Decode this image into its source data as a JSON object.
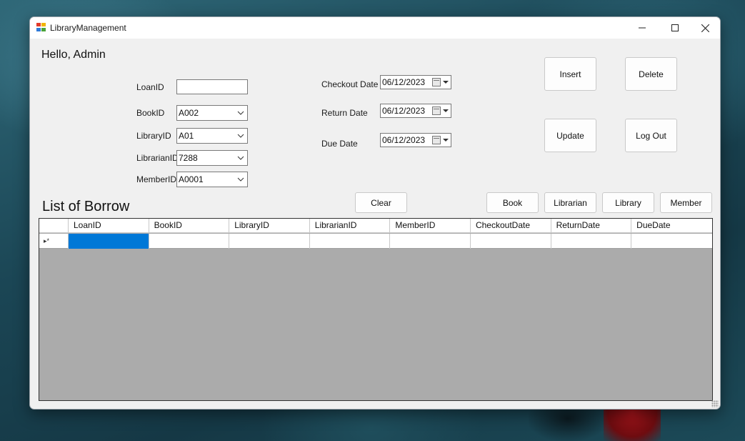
{
  "window": {
    "title": "LibraryManagement"
  },
  "greeting": "Hello, Admin",
  "form": {
    "loan_id": {
      "label": "LoanID",
      "value": ""
    },
    "book_id": {
      "label": "BookID",
      "value": "A002"
    },
    "library_id": {
      "label": "LibraryID",
      "value": "A01"
    },
    "librarian_id": {
      "label": "LibrarianID",
      "value": "7288"
    },
    "member_id": {
      "label": "MemberID",
      "value": "A0001"
    },
    "checkout_date": {
      "label": "Checkout Date",
      "value": "06/12/2023"
    },
    "return_date": {
      "label": "Return Date",
      "value": "06/12/2023"
    },
    "due_date": {
      "label": "Due Date",
      "value": "06/12/2023"
    }
  },
  "buttons": {
    "insert": "Insert",
    "delete": "Delete",
    "update": "Update",
    "logout": "Log Out",
    "clear": "Clear",
    "book": "Book",
    "librarian": "Librarian",
    "library": "Library",
    "member": "Member"
  },
  "list_title": "List of Borrow",
  "grid": {
    "columns": [
      "LoanID",
      "BookID",
      "LibraryID",
      "LibrarianID",
      "MemberID",
      "CheckoutDate",
      "ReturnDate",
      "DueDate"
    ],
    "new_row_marker": "▸*"
  },
  "colors": {
    "selection": "#0078d7",
    "grid_background": "#ababab",
    "window_background": "#f0f0f0"
  }
}
